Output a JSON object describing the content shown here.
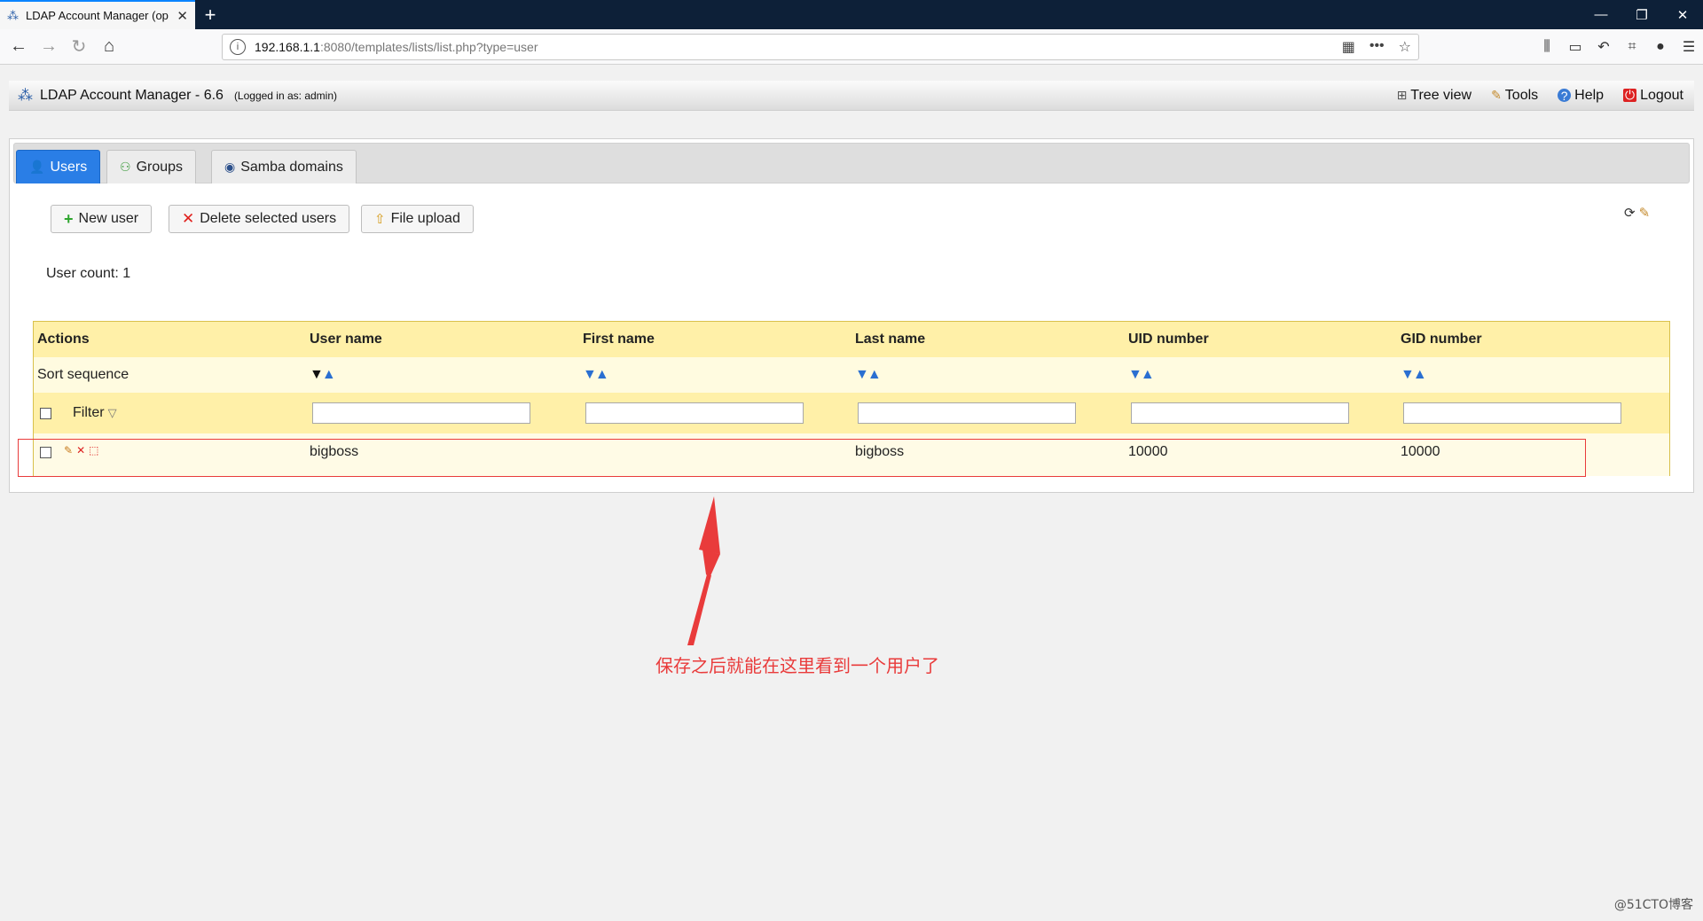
{
  "browser": {
    "tab_title": "LDAP Account Manager (op",
    "url_host": "192.168.1.1",
    "url_rest": ":8080/templates/lists/list.php?type=user"
  },
  "header": {
    "app_title": "LDAP Account Manager - 6.6",
    "logged_in": "(Logged in as: admin)",
    "links": {
      "tree_view": "Tree view",
      "tools": "Tools",
      "help": "Help",
      "logout": "Logout"
    }
  },
  "tabs": {
    "users": "Users",
    "groups": "Groups",
    "samba_domains": "Samba domains"
  },
  "toolbar": {
    "new_user": "New user",
    "delete_selected": "Delete selected users",
    "file_upload": "File upload"
  },
  "user_count": "User count: 1",
  "table": {
    "headers": {
      "actions": "Actions",
      "user_name": "User name",
      "first_name": "First name",
      "last_name": "Last name",
      "uid_number": "UID number",
      "gid_number": "GID number"
    },
    "sort_label": "Sort sequence",
    "filter_label": "Filter",
    "rows": [
      {
        "user_name": "bigboss",
        "first_name": "",
        "last_name": "bigboss",
        "uid_number": "10000",
        "gid_number": "10000"
      }
    ]
  },
  "annotation": {
    "text": "保存之后就能在这里看到一个用户了",
    "color": "#e93b3b"
  },
  "watermark": "@51CTO博客",
  "colors": {
    "active_tab": "#2a7ee6",
    "table_header": "#fff0a8",
    "table_border": "#d9c04c"
  }
}
